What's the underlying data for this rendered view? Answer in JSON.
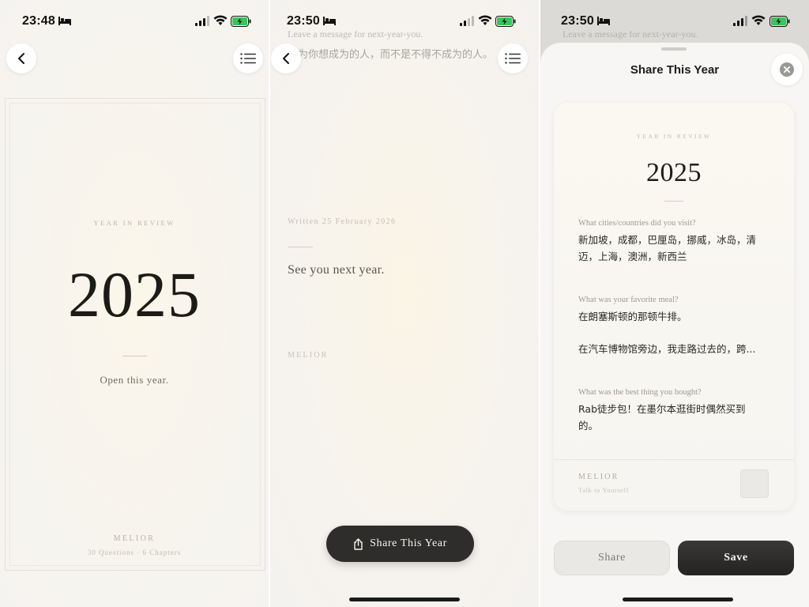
{
  "panel1": {
    "status": {
      "time": "23:48"
    },
    "eyebrow": "YEAR IN REVIEW",
    "year": "2025",
    "subtitle": "Open this year.",
    "brand": "MELIOR",
    "brand_sub": "30 Questions · 6 Chapters"
  },
  "panel2": {
    "status": {
      "time": "23:50"
    },
    "faded_prompt": "Leave a message for next-year-you.",
    "faded_line": "因为你想成为的人，而不是不得不成为的人。",
    "written_date": "Written 25 February 2026",
    "message": "See you next year.",
    "brand": "MELIOR",
    "share_button": "Share This Year"
  },
  "panel3": {
    "status": {
      "time": "23:50"
    },
    "faded_prompt": "Leave a message for next-year-you.",
    "sheet_title": "Share This Year",
    "card": {
      "eyebrow": "YEAR IN REVIEW",
      "year": "2025",
      "qa": [
        {
          "question": "What cities/countries did you visit?",
          "answer": "新加坡，成都，巴厘岛，挪威，冰岛，清迈，上海，澳洲，新西兰"
        },
        {
          "question": "What was your favorite meal?",
          "answer": "在朗塞斯顿的那顿牛排。",
          "answer2": "在汽车博物馆旁边，我走路过去的，跨..."
        },
        {
          "question": "What was the best thing you bought?",
          "answer": "Rab徒步包！在墨尔本逛街时偶然买到的。"
        }
      ],
      "brand": "MELIOR",
      "tagline": "Talk to Yourself"
    },
    "share_button": "Share",
    "save_button": "Save"
  },
  "colors": {
    "accent_dark": "#2f2d2b",
    "battery_green": "#34c759",
    "background": "#f6f3ee"
  },
  "icons": [
    "back-chevron-icon",
    "list-icon",
    "bed-icon",
    "signal-icon",
    "wifi-icon",
    "battery-charging-icon",
    "share-icon",
    "close-icon"
  ]
}
